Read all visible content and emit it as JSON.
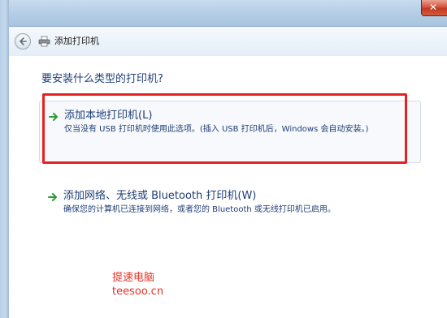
{
  "window": {
    "close_glyph": "✕"
  },
  "nav": {
    "title": "添加打印机",
    "back_icon": "back-arrow-icon",
    "app_icon": "printer-icon"
  },
  "main": {
    "heading": "要安装什么类型的打印机?",
    "options": [
      {
        "title": "添加本地打印机(L)",
        "description": "仅当没有 USB 打印机时使用此选项。(插入 USB 打印机后，Windows 会自动安装。)",
        "icon": "green-arrow-icon"
      },
      {
        "title": "添加网络、无线或 Bluetooth 打印机(W)",
        "description": "确保您的计算机已连接到网络，或者您的 Bluetooth 或无线打印机已启用。",
        "icon": "green-arrow-icon"
      }
    ]
  },
  "watermark": {
    "line1": "提速电脑",
    "line2": "teesoo.cn"
  },
  "colors": {
    "link_text": "#1f3e76",
    "highlight_border": "#e52222",
    "watermark": "#e63226",
    "arrow": "#2f9b35"
  }
}
